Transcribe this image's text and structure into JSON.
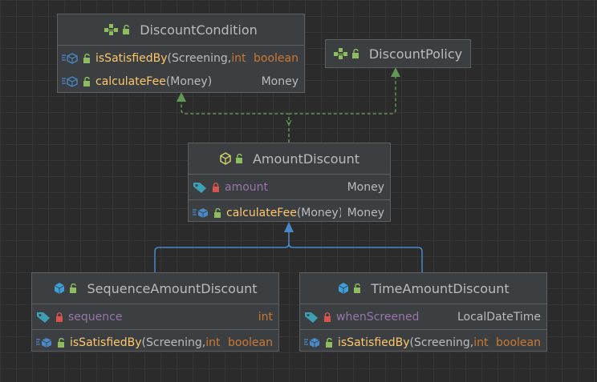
{
  "nodes": {
    "discount_condition": {
      "name": "DiscountCondition",
      "kind": "interface",
      "methods": [
        {
          "name": "isSatisfiedBy",
          "params_open": "(Screening, ",
          "param_kw": "int",
          "params_close": ")",
          "return": "boolean",
          "return_kw": true
        },
        {
          "name": "calculateFee",
          "params_open": "(Money)",
          "param_kw": "",
          "params_close": "",
          "return": "Money",
          "return_kw": false
        }
      ]
    },
    "discount_policy": {
      "name": "DiscountPolicy",
      "kind": "interface"
    },
    "amount_discount": {
      "name": "AmountDiscount",
      "kind": "abstract-class",
      "fields": [
        {
          "name": "amount",
          "type": "Money"
        }
      ],
      "methods": [
        {
          "name": "calculateFee",
          "params_open": "(Money)",
          "param_kw": "",
          "params_close": "",
          "return": "Money",
          "return_kw": false
        }
      ]
    },
    "sequence_amount_discount": {
      "name": "SequenceAmountDiscount",
      "kind": "class",
      "fields": [
        {
          "name": "sequence",
          "type": "int",
          "type_kw": true
        }
      ],
      "methods": [
        {
          "name": "isSatisfiedBy",
          "params_open": "(Screening, ",
          "param_kw": "int",
          "params_close": ")",
          "return": "boolean",
          "return_kw": true
        }
      ]
    },
    "time_amount_discount": {
      "name": "TimeAmountDiscount",
      "kind": "class",
      "fields": [
        {
          "name": "whenScreened",
          "type": "LocalDateTime",
          "type_kw": false
        }
      ],
      "methods": [
        {
          "name": "isSatisfiedBy",
          "params_open": "(Screening, ",
          "param_kw": "int",
          "params_close": ")",
          "return": "boolean",
          "return_kw": true
        }
      ]
    }
  },
  "colors": {
    "background": "#2b2b2b",
    "node_fill": "#3c3f41",
    "node_border": "#5e6060",
    "realization_edge": "#629755",
    "inheritance_edge": "#4a88c7",
    "method_name": "#ffc66d",
    "field_name": "#9876aa",
    "keyword": "#cc7832",
    "text": "#bbbbbb"
  },
  "icons": {
    "interface": "interface-icon",
    "abstract_class": "abstract-class-icon",
    "class": "class-icon",
    "field": "field-tag-icon",
    "method": "method-icon",
    "public": "unlocked-padlock-icon",
    "private": "locked-padlock-icon"
  }
}
